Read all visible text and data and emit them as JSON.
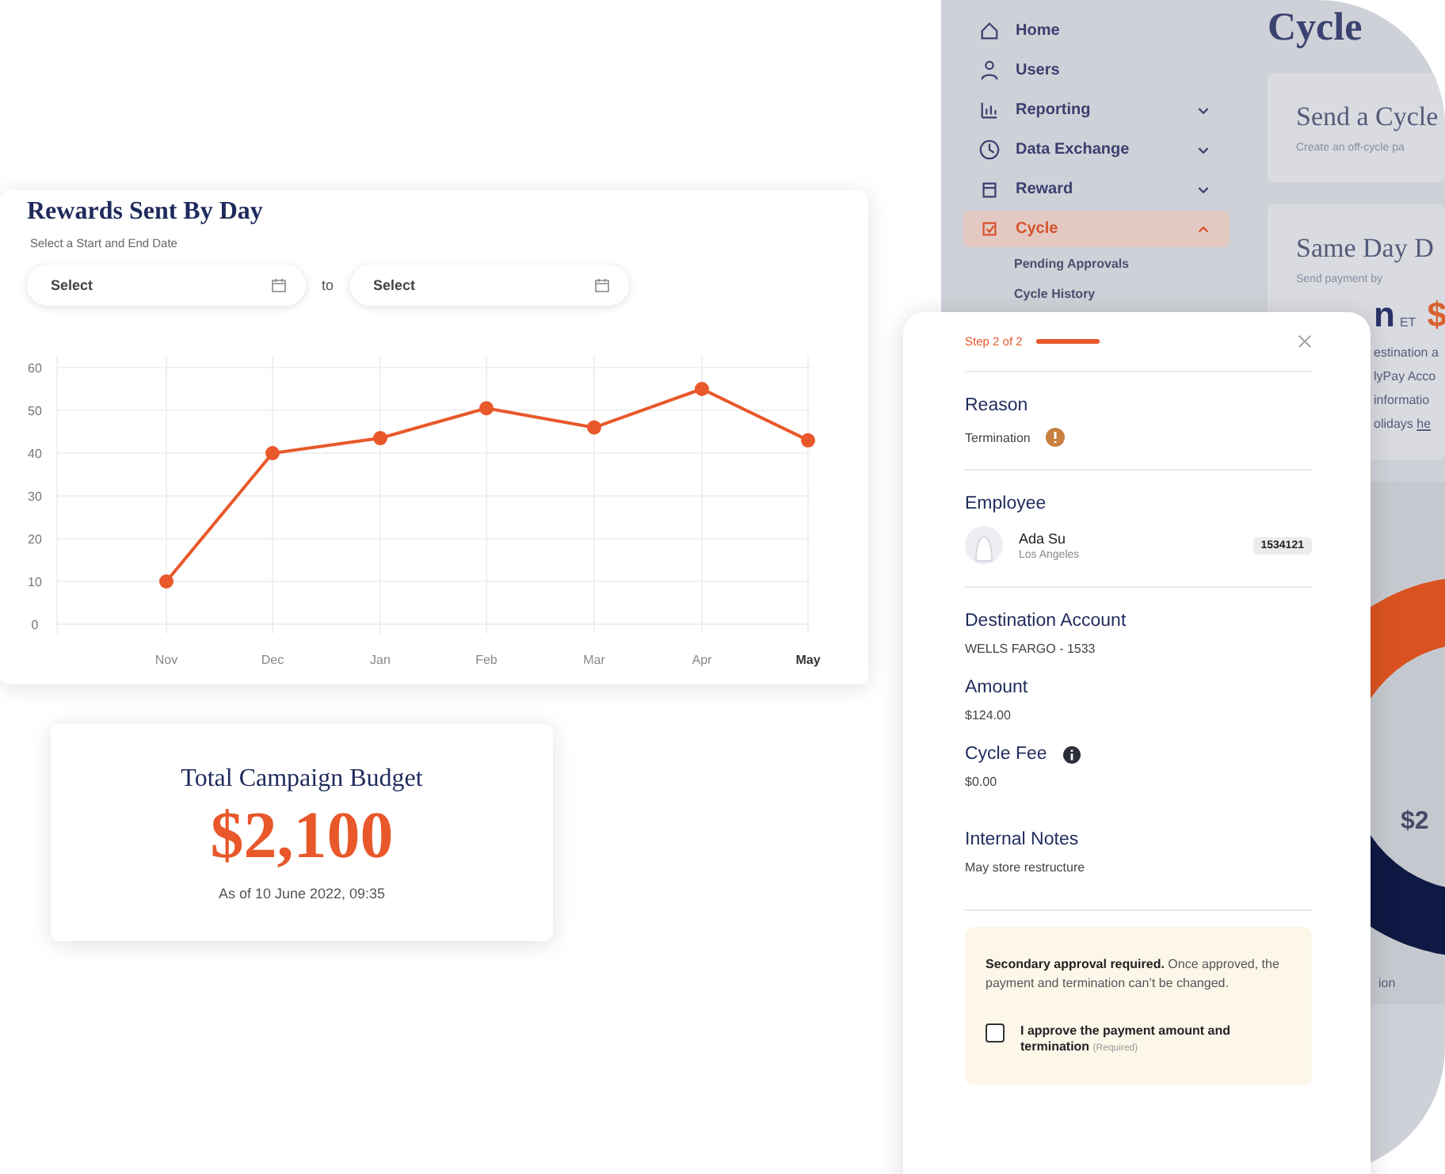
{
  "background_app": {
    "sidebar": {
      "items": [
        {
          "label": "Home",
          "kind": "link",
          "selected": false
        },
        {
          "label": "Users",
          "kind": "link",
          "selected": false
        },
        {
          "label": "Reporting",
          "kind": "group",
          "selected": false,
          "expanded": false
        },
        {
          "label": "Data Exchange",
          "kind": "group",
          "selected": false,
          "expanded": false
        },
        {
          "label": "Reward",
          "kind": "group",
          "selected": false,
          "expanded": false
        },
        {
          "label": "Cycle",
          "kind": "group",
          "selected": true,
          "expanded": true,
          "children": [
            {
              "label": "Pending Approvals"
            },
            {
              "label": "Cycle History"
            }
          ]
        }
      ]
    },
    "page_title": "Cycle",
    "send_card": {
      "title": "Send a Cycle",
      "subtitle": "Create an off-cycle pa"
    },
    "same_day_card": {
      "title": "Same Day D",
      "caption": "Send payment by",
      "time": "n",
      "zone": "ET",
      "price": "$",
      "lines": [
        "estination a",
        "lyPay Acco",
        "informatio"
      ],
      "last_line": "olidays",
      "link": "he"
    },
    "donut": {
      "center": "$2",
      "legend": "ion"
    }
  },
  "chart_card": {
    "title": "Rewards Sent By Day",
    "subtitle": "Select a Start and End Date",
    "start_field": {
      "placeholder": "Select"
    },
    "separator": "to",
    "end_field": {
      "placeholder": "Select"
    },
    "last_tick_bold": true,
    "chart_data": {
      "type": "line",
      "grid": true,
      "marker": true,
      "categories": [
        "Nov",
        "Dec",
        "Jan",
        "Feb",
        "Mar",
        "Apr",
        "May"
      ],
      "values": [
        10,
        40,
        43.5,
        50.5,
        46,
        55,
        43
      ],
      "ylim": [
        0,
        60
      ],
      "yticks": [
        0,
        10,
        20,
        30,
        40,
        50,
        60
      ]
    }
  },
  "budget_card": {
    "title": "Total Campaign Budget",
    "amount": "$2,100",
    "as_of": "As of 10 June 2022, 09:35"
  },
  "modal": {
    "step": "Step 2 of 2",
    "progress": {
      "level": 1
    },
    "reason": {
      "label": "Reason",
      "value": "Termination"
    },
    "employee": {
      "label": "Employee",
      "name": "Ada Su",
      "location": "Los Angeles",
      "id": "1534121"
    },
    "destination": {
      "label": "Destination Account",
      "value": "WELLS FARGO - 1533"
    },
    "amount": {
      "label": "Amount",
      "value": "$124.00"
    },
    "cycle_fee": {
      "label": "Cycle Fee",
      "value": "$0.00"
    },
    "notes": {
      "label": "Internal Notes",
      "value": "May store restructure"
    },
    "notice": {
      "text": "**Secondary approval required.** Once approved, the payment and termination can’t be changed.",
      "checkbox": {
        "label": "I approve the payment amount and termination",
        "hint": "(Required)",
        "checked": false
      }
    }
  }
}
